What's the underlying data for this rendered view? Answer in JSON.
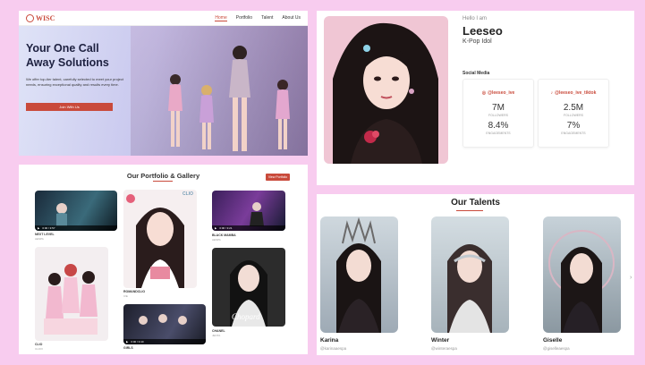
{
  "hero": {
    "logo": "WISC",
    "nav": [
      "Home",
      "Portfolio",
      "Talent",
      "About Us"
    ],
    "title": "Your One Call Away Solutions",
    "description": "We offer top-tier talent, carefully selected to meet your project needs, ensuring exceptional quality and results every time.",
    "cta": "Join With Us"
  },
  "profile": {
    "greeting": "Hello I am",
    "name": "Leeseo",
    "role": "K-Pop Idol",
    "social_title": "Social Media",
    "socials": [
      {
        "icon": "instagram-icon",
        "handle": "@leeseo_ive",
        "followers": "7M",
        "followers_label": "FOLLOWERS",
        "engagement": "8.4%",
        "engagement_label": "ENGAGEMENTS"
      },
      {
        "icon": "tiktok-icon",
        "handle": "@leeseo_ive_tiktok",
        "followers": "2.5M",
        "followers_label": "FOLLOWERS",
        "engagement": "7%",
        "engagement_label": "ENGAGEMENTS"
      }
    ]
  },
  "gallery": {
    "title": "Our Portfolio & Gallery",
    "button": "View Portfolio",
    "items": [
      {
        "caption": "NEXT LEVEL",
        "sub": "AESPA",
        "video_time": "0:00 / 3:57"
      },
      {
        "caption": "CLIO",
        "sub": "CLIOV"
      },
      {
        "caption": "ROMANDCLIO",
        "sub": "IVE",
        "watermark": "CLIO"
      },
      {
        "caption": "GIRLS",
        "sub": "AESPA",
        "video_time": "0:00 / 3:40"
      },
      {
        "caption": "BLACK MAMBA",
        "sub": "AESPA",
        "video_time": "0:00 / 3:21"
      },
      {
        "caption": "CHANEL",
        "sub": "JENTA",
        "watermark": "Chopard"
      }
    ]
  },
  "talents": {
    "title": "Our Talents",
    "items": [
      {
        "name": "Karina",
        "handle": "@karinaaespa"
      },
      {
        "name": "Winter",
        "handle": "@winteraespa"
      },
      {
        "name": "Giselle",
        "handle": "@giselleaespa"
      }
    ],
    "next_icon": "chevron-right-icon"
  },
  "colors": {
    "accent": "#c94a3b",
    "background": "#f8ccef"
  }
}
